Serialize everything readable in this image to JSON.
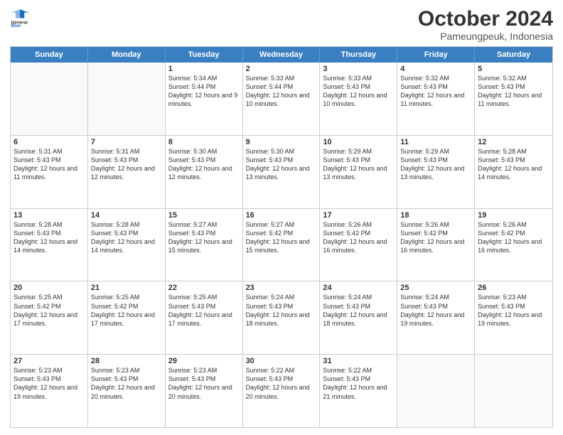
{
  "logo": {
    "general": "General",
    "blue": "Blue"
  },
  "title": "October 2024",
  "subtitle": "Pameungpeuk, Indonesia",
  "days": [
    "Sunday",
    "Monday",
    "Tuesday",
    "Wednesday",
    "Thursday",
    "Friday",
    "Saturday"
  ],
  "rows": [
    [
      {
        "day": "",
        "text": "",
        "empty": true
      },
      {
        "day": "",
        "text": "",
        "empty": true
      },
      {
        "day": "1",
        "text": "Sunrise: 5:34 AM\nSunset: 5:44 PM\nDaylight: 12 hours and 9 minutes."
      },
      {
        "day": "2",
        "text": "Sunrise: 5:33 AM\nSunset: 5:44 PM\nDaylight: 12 hours and 10 minutes."
      },
      {
        "day": "3",
        "text": "Sunrise: 5:33 AM\nSunset: 5:43 PM\nDaylight: 12 hours and 10 minutes."
      },
      {
        "day": "4",
        "text": "Sunrise: 5:32 AM\nSunset: 5:43 PM\nDaylight: 12 hours and 11 minutes."
      },
      {
        "day": "5",
        "text": "Sunrise: 5:32 AM\nSunset: 5:43 PM\nDaylight: 12 hours and 11 minutes."
      }
    ],
    [
      {
        "day": "6",
        "text": "Sunrise: 5:31 AM\nSunset: 5:43 PM\nDaylight: 12 hours and 11 minutes."
      },
      {
        "day": "7",
        "text": "Sunrise: 5:31 AM\nSunset: 5:43 PM\nDaylight: 12 hours and 12 minutes."
      },
      {
        "day": "8",
        "text": "Sunrise: 5:30 AM\nSunset: 5:43 PM\nDaylight: 12 hours and 12 minutes."
      },
      {
        "day": "9",
        "text": "Sunrise: 5:30 AM\nSunset: 5:43 PM\nDaylight: 12 hours and 13 minutes."
      },
      {
        "day": "10",
        "text": "Sunrise: 5:29 AM\nSunset: 5:43 PM\nDaylight: 12 hours and 13 minutes."
      },
      {
        "day": "11",
        "text": "Sunrise: 5:29 AM\nSunset: 5:43 PM\nDaylight: 12 hours and 13 minutes."
      },
      {
        "day": "12",
        "text": "Sunrise: 5:28 AM\nSunset: 5:43 PM\nDaylight: 12 hours and 14 minutes."
      }
    ],
    [
      {
        "day": "13",
        "text": "Sunrise: 5:28 AM\nSunset: 5:43 PM\nDaylight: 12 hours and 14 minutes."
      },
      {
        "day": "14",
        "text": "Sunrise: 5:28 AM\nSunset: 5:43 PM\nDaylight: 12 hours and 14 minutes."
      },
      {
        "day": "15",
        "text": "Sunrise: 5:27 AM\nSunset: 5:43 PM\nDaylight: 12 hours and 15 minutes."
      },
      {
        "day": "16",
        "text": "Sunrise: 5:27 AM\nSunset: 5:42 PM\nDaylight: 12 hours and 15 minutes."
      },
      {
        "day": "17",
        "text": "Sunrise: 5:26 AM\nSunset: 5:42 PM\nDaylight: 12 hours and 16 minutes."
      },
      {
        "day": "18",
        "text": "Sunrise: 5:26 AM\nSunset: 5:42 PM\nDaylight: 12 hours and 16 minutes."
      },
      {
        "day": "19",
        "text": "Sunrise: 5:26 AM\nSunset: 5:42 PM\nDaylight: 12 hours and 16 minutes."
      }
    ],
    [
      {
        "day": "20",
        "text": "Sunrise: 5:25 AM\nSunset: 5:42 PM\nDaylight: 12 hours and 17 minutes."
      },
      {
        "day": "21",
        "text": "Sunrise: 5:25 AM\nSunset: 5:42 PM\nDaylight: 12 hours and 17 minutes."
      },
      {
        "day": "22",
        "text": "Sunrise: 5:25 AM\nSunset: 5:43 PM\nDaylight: 12 hours and 17 minutes."
      },
      {
        "day": "23",
        "text": "Sunrise: 5:24 AM\nSunset: 5:43 PM\nDaylight: 12 hours and 18 minutes."
      },
      {
        "day": "24",
        "text": "Sunrise: 5:24 AM\nSunset: 5:43 PM\nDaylight: 12 hours and 18 minutes."
      },
      {
        "day": "25",
        "text": "Sunrise: 5:24 AM\nSunset: 5:43 PM\nDaylight: 12 hours and 19 minutes."
      },
      {
        "day": "26",
        "text": "Sunrise: 5:23 AM\nSunset: 5:43 PM\nDaylight: 12 hours and 19 minutes."
      }
    ],
    [
      {
        "day": "27",
        "text": "Sunrise: 5:23 AM\nSunset: 5:43 PM\nDaylight: 12 hours and 19 minutes."
      },
      {
        "day": "28",
        "text": "Sunrise: 5:23 AM\nSunset: 5:43 PM\nDaylight: 12 hours and 20 minutes."
      },
      {
        "day": "29",
        "text": "Sunrise: 5:23 AM\nSunset: 5:43 PM\nDaylight: 12 hours and 20 minutes."
      },
      {
        "day": "30",
        "text": "Sunrise: 5:22 AM\nSunset: 5:43 PM\nDaylight: 12 hours and 20 minutes."
      },
      {
        "day": "31",
        "text": "Sunrise: 5:22 AM\nSunset: 5:43 PM\nDaylight: 12 hours and 21 minutes."
      },
      {
        "day": "",
        "text": "",
        "empty": true
      },
      {
        "day": "",
        "text": "",
        "empty": true
      }
    ]
  ]
}
